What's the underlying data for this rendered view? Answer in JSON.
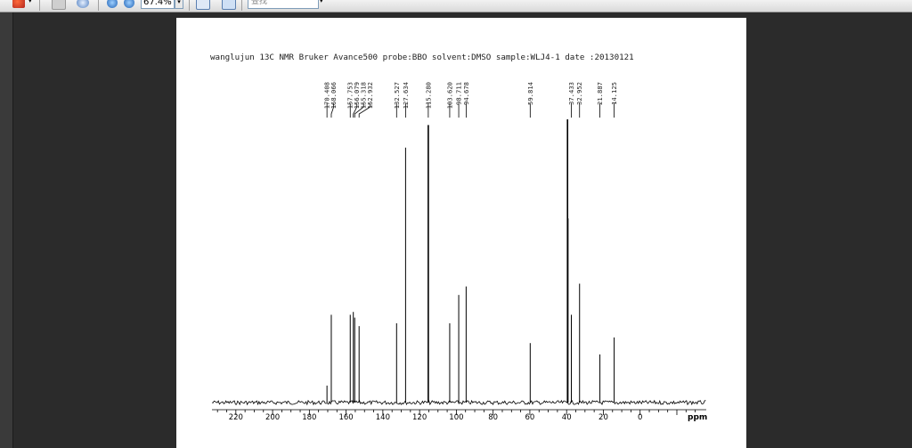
{
  "toolbar": {
    "zoom_value": "67.4%",
    "find_placeholder": "查找"
  },
  "document": {
    "header": "wanglujun 13C NMR Bruker Avance500 probe:BBO solvent:DMSO sample:WLJ4-1 date :20130121"
  },
  "chart_data": {
    "type": "line",
    "title": "wanglujun 13C NMR Bruker Avance500 probe:BBO solvent:DMSO sample:WLJ4-1 date :20130121",
    "xlabel": "ppm",
    "ylabel": "",
    "xlim": [
      233,
      -36
    ],
    "x_reversed": true,
    "grid": false,
    "x_ticks": [
      220,
      200,
      180,
      160,
      140,
      120,
      100,
      80,
      60,
      40,
      20,
      0
    ],
    "peak_labels": [
      "170.408",
      "168.066",
      "157.753",
      "156.079",
      "155.318",
      "152.932",
      "132.527",
      "127.634",
      "115.280",
      "103.620",
      "98.711",
      "94.678",
      "59.814",
      "37.433",
      "32.952",
      "21.887",
      "14.125"
    ],
    "peaks": [
      {
        "x": 170.408,
        "height": 0.06
      },
      {
        "x": 168.066,
        "height": 0.31
      },
      {
        "x": 157.753,
        "height": 0.31
      },
      {
        "x": 156.079,
        "height": 0.32
      },
      {
        "x": 155.318,
        "height": 0.3
      },
      {
        "x": 152.932,
        "height": 0.27
      },
      {
        "x": 132.527,
        "height": 0.28
      },
      {
        "x": 127.634,
        "height": 0.9
      },
      {
        "x": 115.28,
        "height": 0.98
      },
      {
        "x": 103.62,
        "height": 0.28
      },
      {
        "x": 98.711,
        "height": 0.38
      },
      {
        "x": 94.678,
        "height": 0.41
      },
      {
        "x": 59.814,
        "height": 0.21
      },
      {
        "x": 39.5,
        "height": 1.0
      },
      {
        "x": 39.2,
        "height": 0.65
      },
      {
        "x": 37.433,
        "height": 0.31
      },
      {
        "x": 32.952,
        "height": 0.42
      },
      {
        "x": 21.887,
        "height": 0.17
      },
      {
        "x": 14.125,
        "height": 0.23
      }
    ]
  }
}
